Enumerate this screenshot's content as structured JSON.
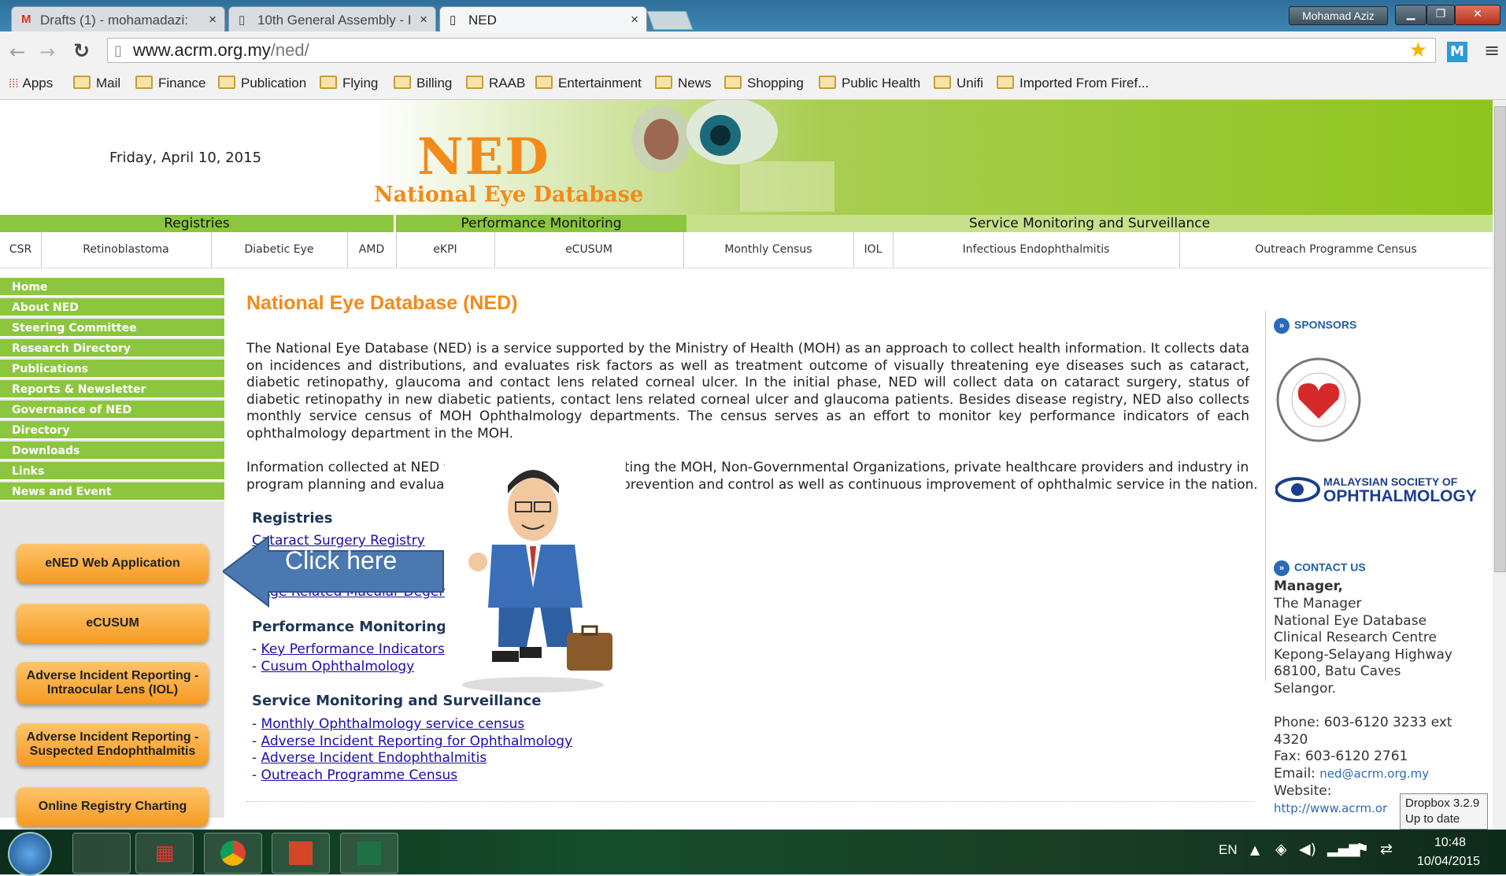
{
  "browser": {
    "tabs": [
      {
        "label": "Drafts (1) - mohamadazi:",
        "icon": "gmail-icon"
      },
      {
        "label": "10th General Assembly - I",
        "icon": "page-icon"
      },
      {
        "label": "NED",
        "icon": "page-icon"
      }
    ],
    "user": "Mohamad Aziz",
    "url_domain": "www.acrm.org.my",
    "url_path": "/ned/",
    "bookmarks": [
      "Apps",
      "Mail",
      "Finance",
      "Publication",
      "Flying",
      "Billing",
      "RAAB",
      "Entertainment",
      "News",
      "Shopping",
      "Public Health",
      "Unifi",
      "Imported From Firef..."
    ]
  },
  "header": {
    "date": "Friday, April 10, 2015",
    "logo_main": "NED",
    "logo_sub": "National Eye Database"
  },
  "menu_top": [
    "Registries",
    "Performance Monitoring",
    "Service Monitoring and Surveillance"
  ],
  "menu_sub": [
    "CSR",
    "Retinoblastoma",
    "Diabetic Eye",
    "AMD",
    "eKPI",
    "eCUSUM",
    "Monthly Census",
    "IOL",
    "Infectious Endophthalmitis",
    "Outreach Programme Census"
  ],
  "sidebar": {
    "nav": [
      "Home",
      "About NED",
      "Steering Committee",
      "Research Directory",
      "Publications",
      "Reports & Newsletter",
      "Governance of NED",
      "Directory",
      "Downloads",
      "Links",
      "News and Event"
    ],
    "buttons": [
      "eNED Web Application",
      "eCUSUM",
      "Adverse Incident Reporting - Intraocular Lens (IOL)",
      "Adverse Incident Reporting - Suspected Endophthalmitis",
      "Online Registry Charting"
    ]
  },
  "main": {
    "title": "National Eye Database (NED)",
    "para1": "The National Eye Database (NED) is a service supported by the Ministry of Health (MOH) as an approach to collect health information. It collects data on incidences and distributions, and evaluates risk factors as well as treatment outcome of visually threatening eye diseases such as cataract, diabetic retinopathy, glaucoma and contact lens related corneal ulcer. In the initial phase, NED will collect data on cataract surgery, status of diabetic retinopathy in new diabetic patients, contact lens related corneal ulcer and glaucoma patients. Besides disease registry, NED also collects monthly service census of MOH Ophthalmology departments. The census serves as an effort to monitor key performance indicators of each ophthalmology department in the MOH.",
    "para2_left_1": "Information collected at NED w",
    "para2_right_1": "sting the MOH, Non-Governmental Organizations, private healthcare providers and industry in",
    "para2_left_2": "program planning and evaluatic",
    "para2_right_2": "prevention and control as well as continuous improvement of ophthalmic service in the nation.",
    "sec_registries": "Registries",
    "reg_link_1": "Cataract Surgery Registry",
    "reg_link_2": "Age Related Macular Degener",
    "sec_perf": "Performance Monitoring",
    "perf_links": [
      "Key Performance Indicators (",
      "Cusum Ophthalmology"
    ],
    "sec_svc": "Service Monitoring and Surveillance",
    "svc_links": [
      "Monthly Ophthalmology service census",
      "Adverse Incident Reporting for Ophthalmology",
      "Adverse Incident Endophthalmitis",
      "Outreach Programme Census"
    ],
    "callout": "Click here"
  },
  "right": {
    "sponsors_heading": "SPONSORS",
    "sponsor2_line1": "MALAYSIAN SOCIETY OF",
    "sponsor2_line2": "OPHTHALMOLOGY",
    "contact_heading": "CONTACT US",
    "manager": "Manager,",
    "addr_lines": [
      "The Manager",
      "National Eye Database",
      "Clinical Research Centre",
      "Kepong-Selayang Highway",
      "68100, Batu Caves",
      "Selangor."
    ],
    "phone": "Phone: 603-6120 3233 ext 4320",
    "fax": "Fax: 603-6120 2761",
    "email_label": "Email: ",
    "email": "ned@acrm.org.my",
    "website_label": "Website:",
    "website": "http://www.acrm.or"
  },
  "tooltip": {
    "line1": "Dropbox 3.2.9",
    "line2": "Up to date"
  },
  "taskbar": {
    "lang": "EN",
    "time": "10:48",
    "date": "10/04/2015",
    "apps": [
      "windows-explorer-icon",
      "apps-grid-icon",
      "chrome-icon",
      "powerpoint-icon",
      "excel-icon"
    ]
  },
  "colors": {
    "accent_orange": "#f38a1a",
    "nav_green": "#8cc63f",
    "link_blue": "#1a0dab"
  }
}
